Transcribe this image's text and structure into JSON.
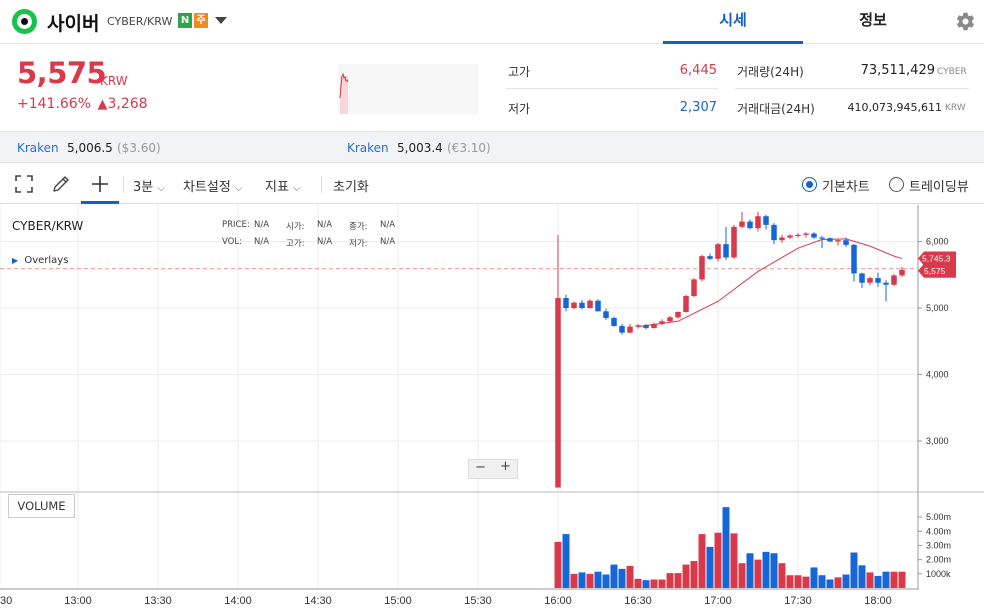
{
  "header": {
    "coin_name": "사이버",
    "pair": "CYBER/KRW",
    "badges": [
      {
        "text": "N",
        "color": "#2aa54a"
      },
      {
        "text": "주",
        "color": "#f18a1c"
      }
    ],
    "tabs": [
      {
        "label": "시세",
        "active": true
      },
      {
        "label": "정보",
        "active": false
      }
    ]
  },
  "summary": {
    "price": "5,575",
    "unit": "KRW",
    "change_pct": "+141.66%",
    "change_arrow": "▲",
    "change_abs": "3,268",
    "high_label": "고가",
    "high_value": "6,445",
    "low_label": "저가",
    "low_value": "2,307",
    "volume_label": "거래량(24H)",
    "volume_value": "73,511,429",
    "volume_unit": "CYBER",
    "amount_label": "거래대금(24H)",
    "amount_value": "410,073,945,611",
    "amount_unit": "KRW"
  },
  "exchanges": [
    {
      "name": "Kraken",
      "value": "5,006.5",
      "sub": "($3.60)"
    },
    {
      "name": "Kraken",
      "value": "5,003.4",
      "sub": "(€3.10)"
    }
  ],
  "toolbar": {
    "interval": "3분",
    "chart_settings": "차트설정",
    "indicators": "지표",
    "reset": "초기화",
    "basic_chart": "기본차트",
    "tradingview": "트레이딩뷰"
  },
  "chart": {
    "symbol": "CYBER/KRW",
    "overlays": "Overlays",
    "ohlc_labels": [
      {
        "label": "PRICE:",
        "value": "N/A"
      },
      {
        "label": "시가:",
        "value": "N/A"
      },
      {
        "label": "종가:",
        "value": "N/A"
      },
      {
        "label": "VOL:",
        "value": "N/A"
      },
      {
        "label": "고가:",
        "value": "N/A"
      },
      {
        "label": "저가:",
        "value": "N/A"
      }
    ],
    "y_ticks": [
      "6,000",
      "5,000",
      "4,000",
      "3,000"
    ],
    "price_tag_ma": "5,745.3",
    "price_tag_last": "5,575",
    "volume_label": "VOLUME",
    "vol_ticks": [
      "5.00m",
      "4.00m",
      "3.00m",
      "2.00m",
      "1000k"
    ],
    "x_ticks": [
      "13:00",
      "13:30",
      "14:00",
      "14:30",
      "15:00",
      "15:30",
      "16:00",
      "16:30",
      "17:00",
      "17:30",
      "18:00"
    ],
    "x_tick_left": "30",
    "zoom_minus": "−",
    "zoom_plus": "+",
    "colors": {
      "up": "#d9394a",
      "down": "#1666d8",
      "ma": "#d9394a"
    }
  },
  "chart_data": {
    "type": "candlestick",
    "x_label": "",
    "y_label": "",
    "ylim": [
      2300,
      6500
    ],
    "candles": [
      {
        "t": "16:00",
        "o": 2300,
        "h": 6100,
        "l": 2300,
        "c": 5150
      },
      {
        "t": "16:03",
        "o": 5150,
        "h": 5200,
        "l": 4950,
        "c": 5000
      },
      {
        "t": "16:06",
        "o": 5000,
        "h": 5100,
        "l": 4980,
        "c": 5080
      },
      {
        "t": "16:09",
        "o": 5080,
        "h": 5120,
        "l": 4980,
        "c": 5000
      },
      {
        "t": "16:12",
        "o": 5000,
        "h": 5130,
        "l": 4990,
        "c": 5110
      },
      {
        "t": "16:15",
        "o": 5110,
        "h": 5130,
        "l": 4950,
        "c": 4950
      },
      {
        "t": "16:18",
        "o": 4950,
        "h": 4990,
        "l": 4820,
        "c": 4850
      },
      {
        "t": "16:21",
        "o": 4850,
        "h": 4870,
        "l": 4720,
        "c": 4730
      },
      {
        "t": "16:24",
        "o": 4730,
        "h": 4760,
        "l": 4600,
        "c": 4630
      },
      {
        "t": "16:27",
        "o": 4630,
        "h": 4760,
        "l": 4620,
        "c": 4720
      },
      {
        "t": "16:30",
        "o": 4720,
        "h": 4760,
        "l": 4690,
        "c": 4740
      },
      {
        "t": "16:33",
        "o": 4740,
        "h": 4760,
        "l": 4680,
        "c": 4700
      },
      {
        "t": "16:36",
        "o": 4700,
        "h": 4780,
        "l": 4690,
        "c": 4760
      },
      {
        "t": "16:39",
        "o": 4760,
        "h": 4830,
        "l": 4740,
        "c": 4800
      },
      {
        "t": "16:42",
        "o": 4800,
        "h": 4880,
        "l": 4790,
        "c": 4860
      },
      {
        "t": "16:45",
        "o": 4860,
        "h": 4950,
        "l": 4840,
        "c": 4940
      },
      {
        "t": "16:48",
        "o": 4940,
        "h": 5200,
        "l": 4930,
        "c": 5180
      },
      {
        "t": "16:51",
        "o": 5180,
        "h": 5450,
        "l": 5160,
        "c": 5430
      },
      {
        "t": "16:54",
        "o": 5430,
        "h": 5800,
        "l": 5400,
        "c": 5780
      },
      {
        "t": "16:57",
        "o": 5780,
        "h": 5820,
        "l": 5720,
        "c": 5740
      },
      {
        "t": "17:00",
        "o": 5740,
        "h": 5980,
        "l": 5700,
        "c": 5960
      },
      {
        "t": "17:03",
        "o": 5960,
        "h": 6220,
        "l": 5720,
        "c": 5760
      },
      {
        "t": "17:06",
        "o": 5760,
        "h": 6250,
        "l": 5740,
        "c": 6220
      },
      {
        "t": "17:09",
        "o": 6220,
        "h": 6445,
        "l": 6200,
        "c": 6300
      },
      {
        "t": "17:12",
        "o": 6300,
        "h": 6330,
        "l": 6180,
        "c": 6200
      },
      {
        "t": "17:15",
        "o": 6200,
        "h": 6445,
        "l": 6150,
        "c": 6380
      },
      {
        "t": "17:18",
        "o": 6380,
        "h": 6400,
        "l": 6180,
        "c": 6250
      },
      {
        "t": "17:21",
        "o": 6250,
        "h": 6280,
        "l": 5960,
        "c": 6020
      },
      {
        "t": "17:24",
        "o": 6020,
        "h": 6100,
        "l": 5980,
        "c": 6060
      },
      {
        "t": "17:27",
        "o": 6060,
        "h": 6110,
        "l": 6040,
        "c": 6090
      },
      {
        "t": "17:30",
        "o": 6090,
        "h": 6130,
        "l": 6060,
        "c": 6100
      },
      {
        "t": "17:33",
        "o": 6100,
        "h": 6140,
        "l": 6060,
        "c": 6120
      },
      {
        "t": "17:36",
        "o": 6120,
        "h": 6140,
        "l": 6040,
        "c": 6060
      },
      {
        "t": "17:39",
        "o": 6060,
        "h": 6080,
        "l": 5900,
        "c": 6050
      },
      {
        "t": "17:42",
        "o": 6050,
        "h": 6060,
        "l": 5990,
        "c": 6000
      },
      {
        "t": "17:45",
        "o": 6000,
        "h": 6040,
        "l": 5940,
        "c": 6020
      },
      {
        "t": "17:48",
        "o": 6020,
        "h": 6060,
        "l": 5920,
        "c": 5950
      },
      {
        "t": "17:51",
        "o": 5950,
        "h": 5960,
        "l": 5400,
        "c": 5520
      },
      {
        "t": "17:54",
        "o": 5520,
        "h": 5530,
        "l": 5300,
        "c": 5380
      },
      {
        "t": "17:57",
        "o": 5380,
        "h": 5470,
        "l": 5340,
        "c": 5450
      },
      {
        "t": "18:00",
        "o": 5450,
        "h": 5530,
        "l": 5320,
        "c": 5380
      },
      {
        "t": "18:03",
        "o": 5380,
        "h": 5420,
        "l": 5100,
        "c": 5350
      },
      {
        "t": "18:06",
        "o": 5350,
        "h": 5510,
        "l": 5330,
        "c": 5490
      },
      {
        "t": "18:09",
        "o": 5490,
        "h": 5620,
        "l": 5470,
        "c": 5575
      }
    ],
    "ma": [
      {
        "t": "16:30",
        "v": 4720
      },
      {
        "t": "16:45",
        "v": 4800
      },
      {
        "t": "17:00",
        "v": 5100
      },
      {
        "t": "17:15",
        "v": 5550
      },
      {
        "t": "17:30",
        "v": 5900
      },
      {
        "t": "17:39",
        "v": 6030
      },
      {
        "t": "17:48",
        "v": 6040
      },
      {
        "t": "17:57",
        "v": 5930
      },
      {
        "t": "18:06",
        "v": 5780
      },
      {
        "t": "18:09",
        "v": 5745.3
      }
    ],
    "volume": [
      3.25,
      3.8,
      1.0,
      1.1,
      1.0,
      1.15,
      0.95,
      1.65,
      1.35,
      1.55,
      0.65,
      0.55,
      0.6,
      0.6,
      1.05,
      1.05,
      1.65,
      1.9,
      3.8,
      2.9,
      3.9,
      5.7,
      3.85,
      1.75,
      2.45,
      2.0,
      2.55,
      2.45,
      1.75,
      0.9,
      0.9,
      0.8,
      1.45,
      0.9,
      0.6,
      0.75,
      0.95,
      2.5,
      1.6,
      1.1,
      0.85,
      1.15,
      1.15,
      1.15
    ],
    "volume_unit": "m"
  }
}
